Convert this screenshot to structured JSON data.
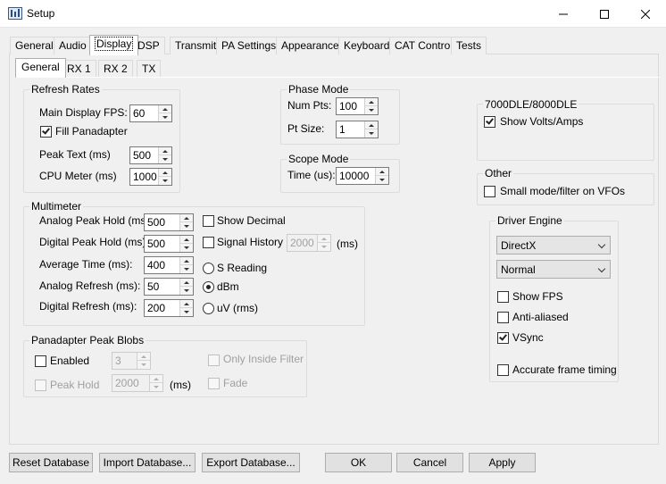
{
  "window": {
    "title": "Setup"
  },
  "main_tabs": [
    {
      "label": "General"
    },
    {
      "label": "Audio"
    },
    {
      "label": "Display"
    },
    {
      "label": "DSP"
    },
    {
      "label": "Transmit"
    },
    {
      "label": "PA Settings"
    },
    {
      "label": "Appearance"
    },
    {
      "label": "Keyboard"
    },
    {
      "label": "CAT Control"
    },
    {
      "label": "Tests"
    }
  ],
  "sub_tabs": [
    {
      "label": "General"
    },
    {
      "label": "RX 1"
    },
    {
      "label": "RX 2"
    },
    {
      "label": "TX"
    }
  ],
  "refresh_rates": {
    "title": "Refresh Rates",
    "main_fps_label": "Main Display FPS:",
    "main_fps_value": "60",
    "fill_panadapter_label": "Fill Panadapter",
    "fill_panadapter_checked": true,
    "peak_text_label": "Peak Text (ms)",
    "peak_text_value": "500",
    "cpu_meter_label": "CPU Meter (ms)",
    "cpu_meter_value": "1000"
  },
  "phase_mode": {
    "title": "Phase Mode",
    "num_pts_label": "Num Pts:",
    "num_pts_value": "100",
    "pt_size_label": "Pt Size:",
    "pt_size_value": "1"
  },
  "scope_mode": {
    "title": "Scope Mode",
    "time_label": "Time (us):",
    "time_value": "10000"
  },
  "dle": {
    "title": "7000DLE/8000DLE",
    "show_volts_label": "Show Volts/Amps",
    "show_volts_checked": true
  },
  "other": {
    "title": "Other",
    "small_mode_label": "Small mode/filter on VFOs",
    "small_mode_checked": false
  },
  "multimeter": {
    "title": "Multimeter",
    "analog_peak_label": "Analog Peak Hold (ms):",
    "analog_peak_value": "500",
    "digital_peak_label": "Digital Peak Hold (ms):",
    "digital_peak_value": "500",
    "avg_time_label": "Average Time (ms):",
    "avg_time_value": "400",
    "analog_refresh_label": "Analog Refresh (ms):",
    "analog_refresh_value": "50",
    "digital_refresh_label": "Digital Refresh (ms):",
    "digital_refresh_value": "200",
    "show_decimal_label": "Show Decimal",
    "signal_history_label": "Signal History",
    "signal_history_value": "2000",
    "signal_history_unit": "(ms)",
    "s_reading_label": "S Reading",
    "dbm_label": "dBm",
    "uv_label": "uV (rms)",
    "selected_mode": "dBm"
  },
  "peak_blobs": {
    "title": "Panadapter Peak Blobs",
    "enabled_label": "Enabled",
    "enabled_value": "3",
    "only_inside_label": "Only Inside Filter",
    "peak_hold_label": "Peak Hold",
    "peak_hold_value": "2000",
    "peak_hold_unit": "(ms)",
    "fade_label": "Fade"
  },
  "driver_engine": {
    "title": "Driver Engine",
    "renderer": "DirectX",
    "quality": "Normal",
    "show_fps_label": "Show FPS",
    "show_fps_checked": false,
    "anti_aliased_label": "Anti-aliased",
    "anti_aliased_checked": false,
    "vsync_label": "VSync",
    "vsync_checked": true,
    "accurate_timing_label": "Accurate frame timing",
    "accurate_timing_checked": false
  },
  "footer": {
    "reset_db": "Reset Database",
    "import_db": "Import Database...",
    "export_db": "Export Database...",
    "ok": "OK",
    "cancel": "Cancel",
    "apply": "Apply"
  }
}
